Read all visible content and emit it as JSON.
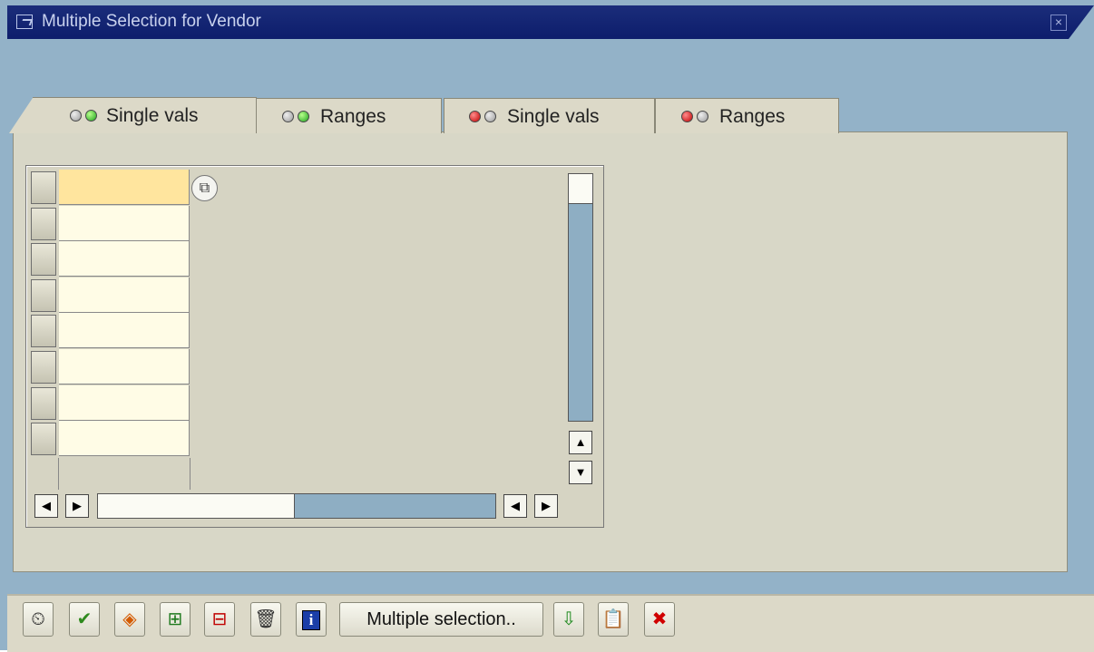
{
  "window": {
    "title": "Multiple Selection for Vendor"
  },
  "tabs": [
    {
      "label": "Single vals",
      "lights": [
        "gray",
        "green"
      ],
      "active": true
    },
    {
      "label": "Ranges",
      "lights": [
        "gray",
        "green"
      ],
      "active": false
    },
    {
      "label": "Single vals",
      "lights": [
        "red",
        "gray"
      ],
      "active": false
    },
    {
      "label": "Ranges",
      "lights": [
        "red",
        "gray"
      ],
      "active": false
    }
  ],
  "table": {
    "rows": [
      "",
      "",
      "",
      "",
      "",
      "",
      "",
      ""
    ],
    "active_row": 0
  },
  "toolbar": {
    "buttons": [
      {
        "name": "execute-button",
        "icon": "clock-execute-icon",
        "glyph": "⏲",
        "color": "#333333"
      },
      {
        "name": "copy-button",
        "icon": "checkmark-icon",
        "glyph": "✔",
        "color": "#2f8a1e"
      },
      {
        "name": "check-entries-button",
        "icon": "diamond-arrows-icon",
        "glyph": "◈",
        "color": "#d45a00"
      },
      {
        "name": "insert-line-button",
        "icon": "insert-row-icon",
        "glyph": "⊞",
        "color": "#1f7a1f"
      },
      {
        "name": "delete-line-button",
        "icon": "delete-row-icon",
        "glyph": "⊟",
        "color": "#c00000"
      },
      {
        "name": "delete-all-button",
        "icon": "trash-icon",
        "glyph": "🗑",
        "color": "#333333"
      },
      {
        "name": "info-button",
        "icon": "info-icon",
        "glyph": "i",
        "color": "#1a3ea8"
      }
    ],
    "multiple_selection_label": "Multiple selection..",
    "right_buttons": [
      {
        "name": "import-text-button",
        "icon": "import-icon",
        "glyph": "⇩",
        "color": "#1f8a1f"
      },
      {
        "name": "upload-clipboard-button",
        "icon": "clipboard-icon",
        "glyph": "📋",
        "color": "#c8a200"
      },
      {
        "name": "cancel-button",
        "icon": "cancel-x-icon",
        "glyph": "✖",
        "color": "#d00000"
      }
    ]
  }
}
